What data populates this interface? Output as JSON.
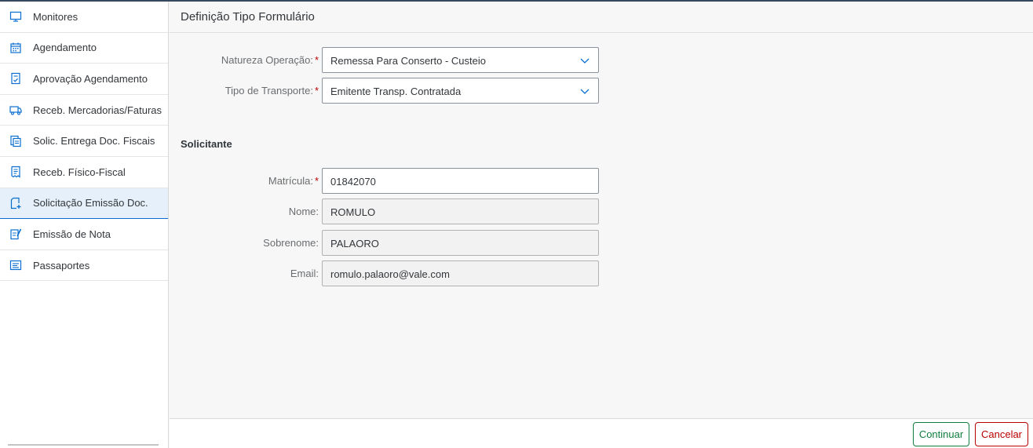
{
  "sidebar": {
    "items": [
      {
        "label": "Monitores",
        "icon": "monitor-icon"
      },
      {
        "label": "Agendamento",
        "icon": "calendar-icon"
      },
      {
        "label": "Aprovação Agendamento",
        "icon": "approval-document-icon"
      },
      {
        "label": "Receb. Mercadorias/Faturas",
        "icon": "truck-icon"
      },
      {
        "label": "Solic. Entrega Doc. Fiscais",
        "icon": "documents-icon"
      },
      {
        "label": "Receb. Físico-Fiscal",
        "icon": "receipt-icon"
      },
      {
        "label": "Solicitação Emissão Doc.",
        "icon": "add-document-icon",
        "active": true
      },
      {
        "label": "Emissão de Nota",
        "icon": "sign-document-icon"
      },
      {
        "label": "Passaportes",
        "icon": "list-card-icon"
      }
    ]
  },
  "header": {
    "title": "Definição Tipo Formulário"
  },
  "form": {
    "natureza": {
      "label": "Natureza Operação:",
      "value": "Remessa Para Conserto - Custeio",
      "required": "*"
    },
    "transporte": {
      "label": "Tipo de Transporte:",
      "value": "Emitente Transp. Contratada",
      "required": "*"
    },
    "section_title": "Solicitante",
    "matricula": {
      "label": "Matrícula:",
      "value": "01842070",
      "required": "*"
    },
    "nome": {
      "label": "Nome:",
      "value": "ROMULO"
    },
    "sobrenome": {
      "label": "Sobrenome:",
      "value": "PALAORO"
    },
    "email": {
      "label": "Email:",
      "value": "romulo.palaoro@vale.com"
    }
  },
  "footer": {
    "continue_label": "Continuar",
    "cancel_label": "Cancelar"
  },
  "colors": {
    "accent": "#0a6ed1",
    "positive": "#107e3e",
    "negative": "#bb0000",
    "required": "#bb0000"
  }
}
